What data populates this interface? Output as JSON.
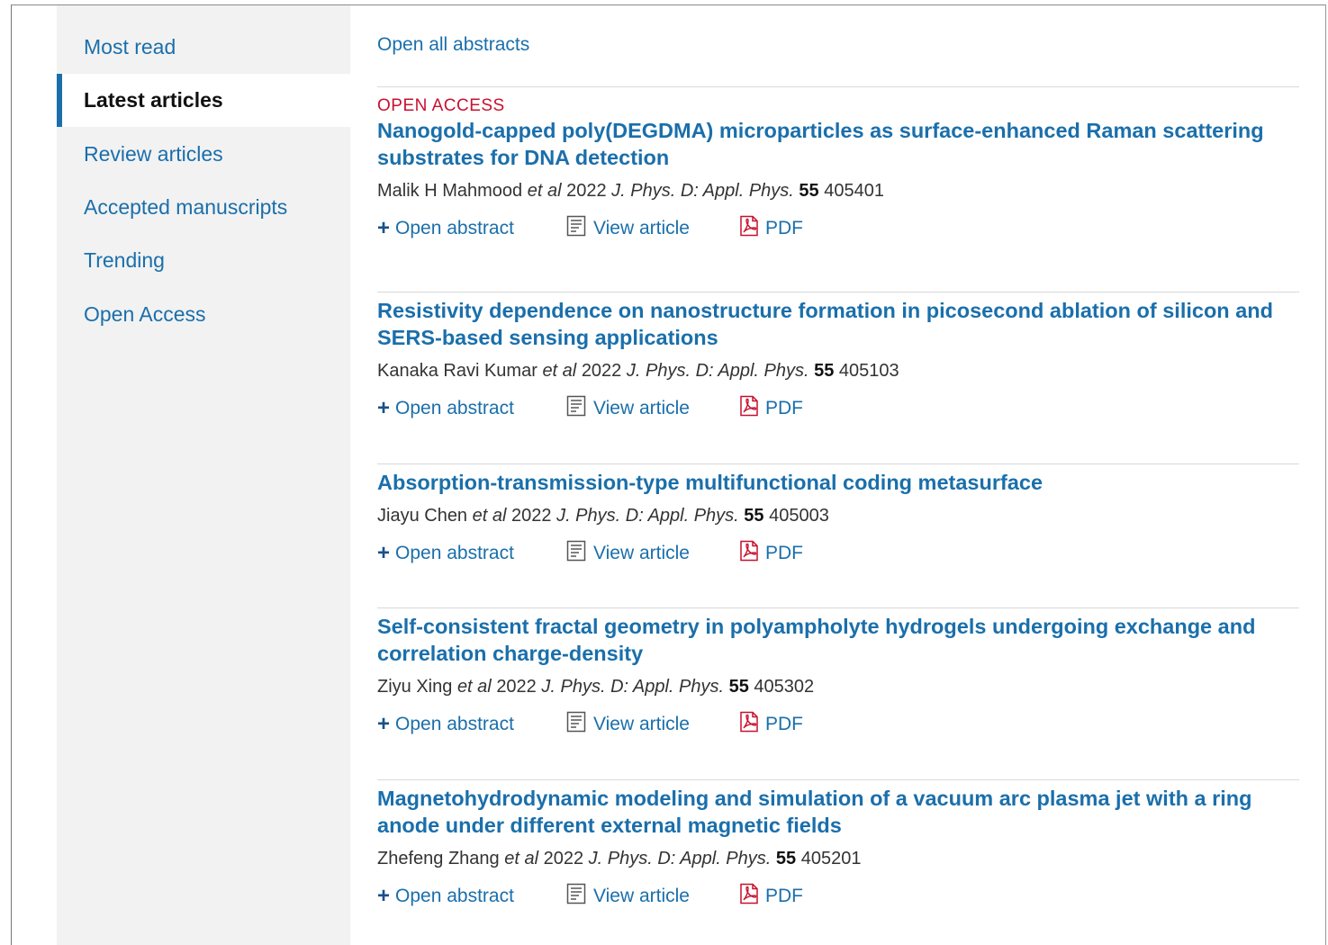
{
  "sidebar": {
    "items": [
      {
        "label": "Most read",
        "active": false
      },
      {
        "label": "Latest articles",
        "active": true
      },
      {
        "label": "Review articles",
        "active": false
      },
      {
        "label": "Accepted manuscripts",
        "active": false
      },
      {
        "label": "Trending",
        "active": false
      },
      {
        "label": "Open Access",
        "active": false
      }
    ]
  },
  "main": {
    "open_all_label": "Open all abstracts",
    "open_abstract_label": "Open abstract",
    "view_article_label": "View article",
    "pdf_label": "PDF",
    "articles": [
      {
        "badge": "OPEN ACCESS",
        "title": "Nanogold-capped poly(DEGDMA) microparticles as surface-enhanced Raman scattering substrates for DNA detection",
        "authors": "Malik H Mahmood",
        "etal": "et al",
        "year": "2022",
        "journal": "J. Phys. D: Appl. Phys.",
        "volume": "55",
        "article_no": "405401"
      },
      {
        "badge": "",
        "title": "Resistivity dependence on nanostructure formation in picosecond ablation of silicon and SERS-based sensing applications",
        "authors": "Kanaka Ravi Kumar",
        "etal": "et al",
        "year": "2022",
        "journal": "J. Phys. D: Appl. Phys.",
        "volume": "55",
        "article_no": "405103"
      },
      {
        "badge": "",
        "title": "Absorption-transmission-type multifunctional coding metasurface",
        "authors": "Jiayu Chen",
        "etal": "et al",
        "year": "2022",
        "journal": "J. Phys. D: Appl. Phys.",
        "volume": "55",
        "article_no": "405003"
      },
      {
        "badge": "",
        "title": "Self-consistent fractal geometry in polyampholyte hydrogels undergoing exchange and correlation charge-density",
        "authors": "Ziyu Xing",
        "etal": "et al",
        "year": "2022",
        "journal": "J. Phys. D: Appl. Phys.",
        "volume": "55",
        "article_no": "405302"
      },
      {
        "badge": "",
        "title": "Magnetohydrodynamic modeling and simulation of a vacuum arc plasma jet with a ring anode under different external magnetic fields",
        "authors": "Zhefeng Zhang",
        "etal": "et al",
        "year": "2022",
        "journal": "J. Phys. D: Appl. Phys.",
        "volume": "55",
        "article_no": "405201"
      }
    ]
  },
  "colors": {
    "link": "#1a6fab",
    "badge": "#c8102e",
    "sidebar_bg": "#f2f2f2"
  },
  "icons": {
    "open_abstract": "plus-icon",
    "view_article": "document-icon",
    "pdf": "pdf-icon"
  }
}
